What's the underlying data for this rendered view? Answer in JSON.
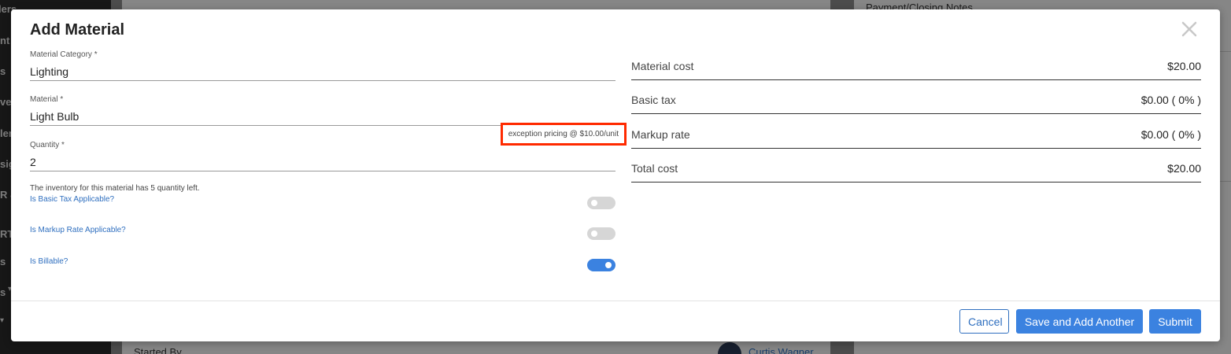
{
  "background": {
    "sidebar_fragments": [
      "lers",
      "nt",
      "s",
      "ve",
      "ler",
      "sig",
      "R &",
      "RT",
      "s",
      "s"
    ],
    "right_panel_label": "Payment/Closing Notes",
    "started_by_label": "Started By",
    "started_by_user": "Curtis Wagner"
  },
  "modal": {
    "title": "Add Material",
    "close_icon": "close-icon"
  },
  "form": {
    "category": {
      "label": "Material Category *",
      "value": "Lighting"
    },
    "material": {
      "label": "Material *",
      "value": "Light Bulb"
    },
    "exception_text": "exception pricing @ $10.00/unit",
    "quantity": {
      "label": "Quantity *",
      "value": "2"
    },
    "inventory_hint": "The inventory for this material has 5 quantity left.",
    "toggles": [
      {
        "label": "Is Basic Tax Applicable?",
        "on": false
      },
      {
        "label": "Is Markup Rate Applicable?",
        "on": false
      },
      {
        "label": "Is Billable?",
        "on": true
      }
    ]
  },
  "summary": [
    {
      "label": "Material cost",
      "value": "$20.00"
    },
    {
      "label": "Basic tax",
      "value": "$0.00 ( 0% )"
    },
    {
      "label": "Markup rate",
      "value": "$0.00 ( 0% )"
    },
    {
      "label": "Total cost",
      "value": "$20.00"
    }
  ],
  "footer": {
    "cancel_label": "Cancel",
    "save_another_label": "Save and Add Another",
    "submit_label": "Submit"
  },
  "colors": {
    "accent": "#3b82e0",
    "highlight": "#ff2a00",
    "link": "#2f6fbf"
  }
}
